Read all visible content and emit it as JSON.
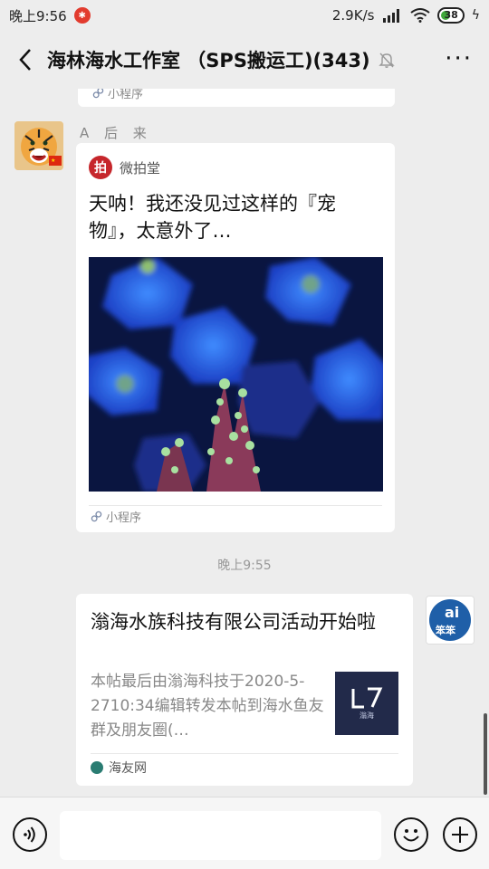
{
  "status_bar": {
    "time": "晚上9:56",
    "network_speed": "2.9K/s",
    "battery_level": "38",
    "app_icon": "app-notification-icon"
  },
  "header": {
    "title": "海林海水工作室 （SPS搬运工)(343)",
    "back_icon": "back-arrow-icon",
    "mute_icon": "bell-off-icon",
    "more_label": "···"
  },
  "messages": {
    "prev_card": {
      "footer_label": "小程序"
    },
    "mini_program": {
      "sender": "A 后 来",
      "source_name": "微拍堂",
      "source_logo_char": "拍",
      "title": "天呐！我还没见过这样的『宠物』，太意外了…",
      "footer_label": "小程序"
    },
    "timestamp": "晚上9:55",
    "link_share": {
      "title": "滃海水族科技有限公司活动开始啦",
      "description": "本帖最后由滃海科技于2020-5-2710:34编辑转发本帖到海水鱼友群及朋友圈(…",
      "thumb_sub": "滃海",
      "footer_source": "海友网",
      "sender_avatar_text": "笨笨"
    }
  },
  "input_bar": {
    "placeholder": "",
    "voice_icon": "voice-icon",
    "emoji_icon": "emoji-icon",
    "plus_icon": "plus-icon"
  },
  "colors": {
    "chat_bg": "#ededed",
    "card_bg": "#ffffff",
    "mini_logo": "#c6262b"
  }
}
